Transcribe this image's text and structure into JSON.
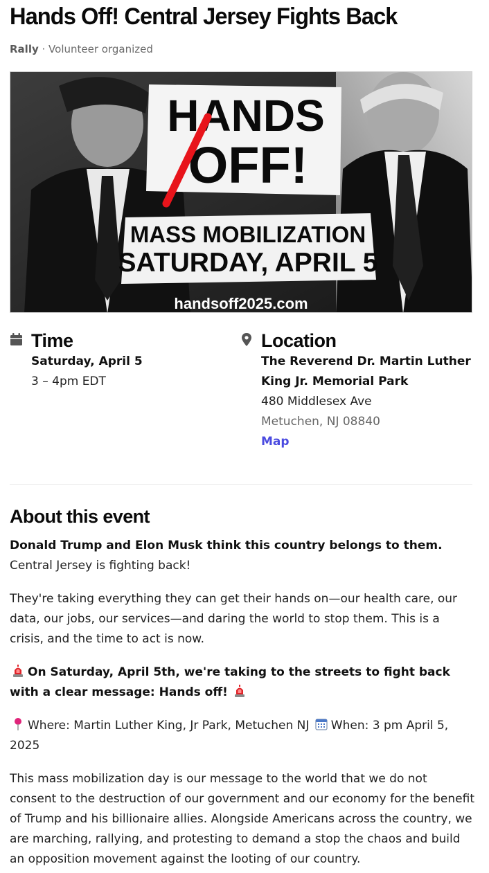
{
  "event": {
    "title": "Hands Off! Central Jersey Fights Back",
    "type": "Rally",
    "separator": " · ",
    "organizer": "Volunteer organized"
  },
  "hero": {
    "headline_top": "HANDS",
    "headline_bottom": "OFF!",
    "banner_line1": "MASS MOBILIZATION",
    "banner_line2": "SATURDAY, APRIL 5",
    "url": "handsoff2025.com"
  },
  "time": {
    "heading": "Time",
    "date": "Saturday, April 5",
    "hours": "3 – 4pm EDT"
  },
  "location": {
    "heading": "Location",
    "name_line1": "The Reverend Dr. Martin Luther",
    "name_line2": "King Jr. Memorial Park",
    "street": "480 Middlesex Ave",
    "city": "Metuchen, NJ 08840",
    "map_link": "Map"
  },
  "about": {
    "heading": "About this event",
    "p1_bold": "Donald Trump and Elon Musk think this country belongs to them.",
    "p1_rest": " Central Jersey is fighting back!",
    "p2": "They're taking everything they can get their hands on—our health care, our data, our jobs, our services—and daring the world to stop them. This is a crisis, and the time to act is now.",
    "p3_bold": "On Saturday, April 5th, we're taking to the streets to fight back with a clear message: Hands off!",
    "p4_where": "Where: Martin Luther King, Jr Park, Metuchen NJ",
    "p4_when": "When: 3 pm April 5, 2025",
    "p5": "This mass mobilization day is our message to the world that we do not consent to the destruction of our government and our economy for the benefit of Trump and his billionaire allies. Alongside Americans across the country, we are marching, rallying, and protesting to demand a stop the chaos and build an opposition movement against the looting of our country."
  },
  "icons": {
    "time": "calendar-icon",
    "location": "map-pin-icon",
    "siren": "siren-emoji-icon",
    "pushpin": "pushpin-emoji-icon",
    "spiral_calendar": "calendar-emoji-icon"
  },
  "colors": {
    "link": "#4b4be0",
    "strike": "#e8141b",
    "muted_text": "#6b6b6b"
  }
}
